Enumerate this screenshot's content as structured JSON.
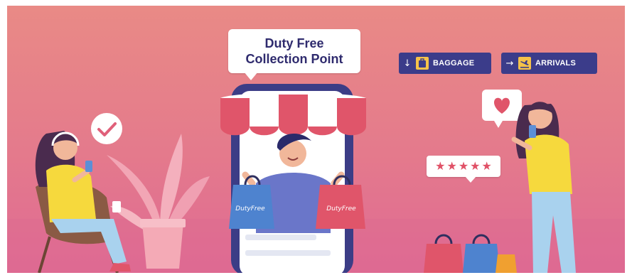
{
  "callout": {
    "line1": "Duty Free",
    "line2": "Collection Point"
  },
  "signs": [
    {
      "arrow": "↓",
      "icon": "baggage-icon",
      "label": "BAGGAGE"
    },
    {
      "arrow": "→",
      "icon": "plane-arrivals-icon",
      "label": "ARRIVALS"
    }
  ],
  "bag_label": "DutyFree",
  "rating": {
    "stars": 5
  },
  "colors": {
    "bg_top": "#e98a86",
    "bg_bottom": "#df6a93",
    "sign_bg": "#3b3c8a",
    "accent_yellow": "#f5c24a",
    "star": "#e05167",
    "heading_text": "#2f2b6e"
  }
}
